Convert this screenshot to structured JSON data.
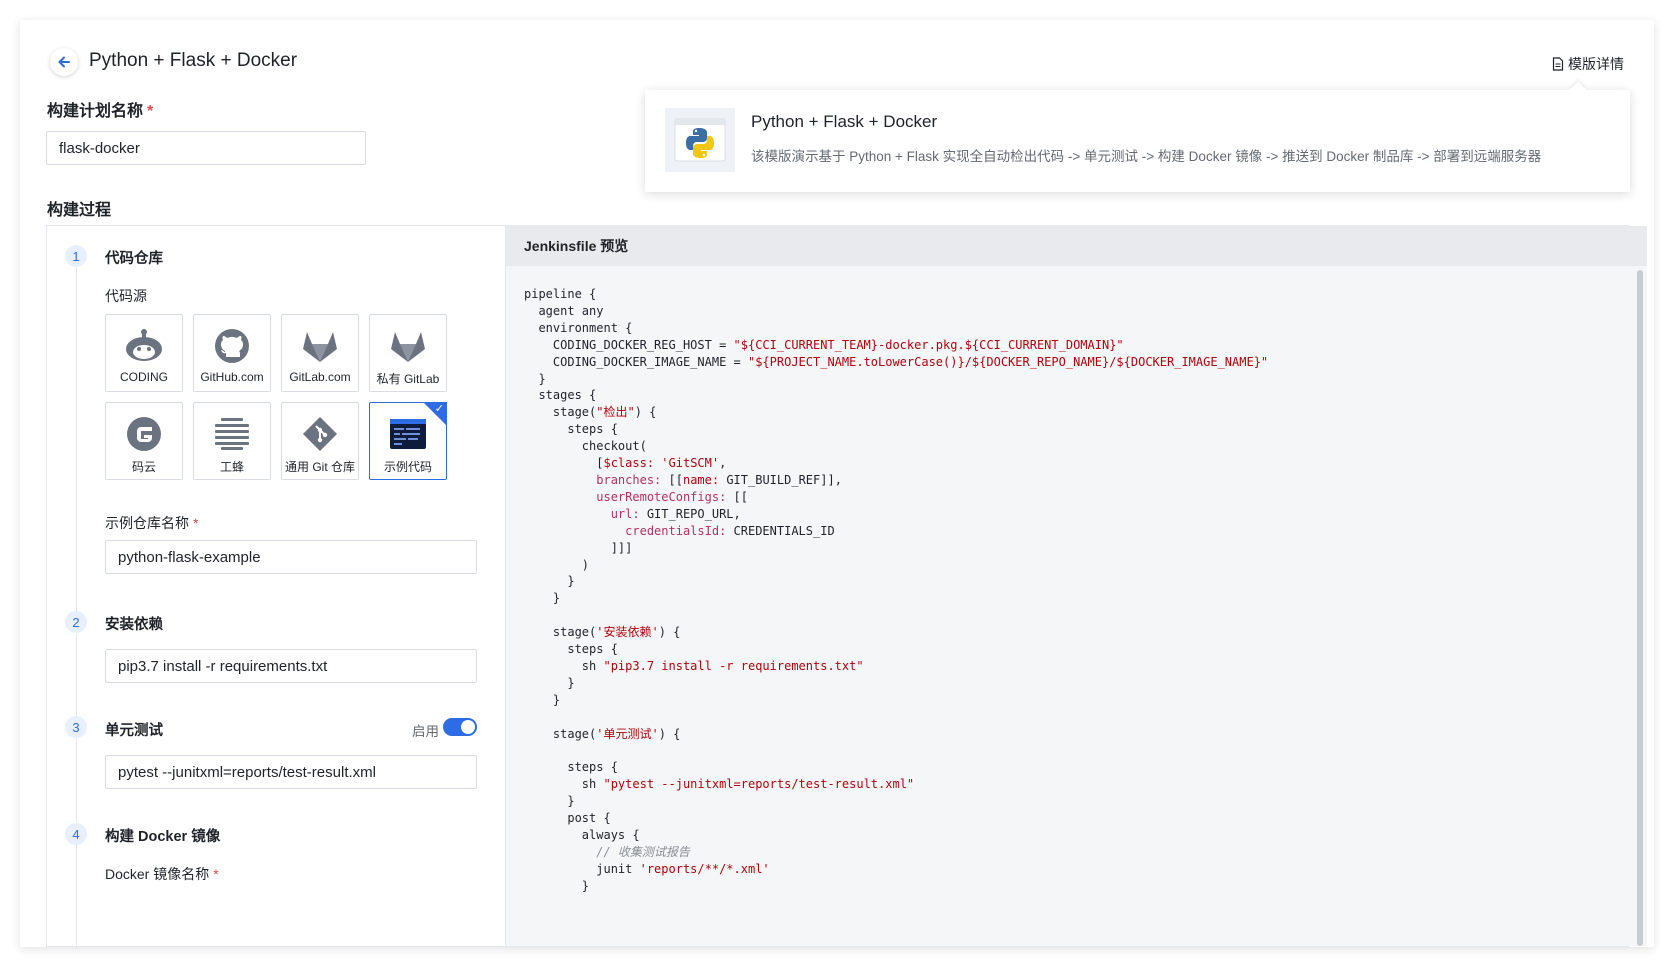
{
  "header": {
    "title": "Python + Flask + Docker",
    "template_link": "模版详情"
  },
  "popover": {
    "title": "Python + Flask + Docker",
    "description": "该模版演示基于 Python + Flask 实现全自动检出代码 -> 单元测试 -> 构建 Docker 镜像 -> 推送到 Docker 制品库 -> 部署到远端服务器"
  },
  "plan": {
    "label": "构建计划名称",
    "required_mark": "*",
    "value": "flask-docker"
  },
  "process": {
    "label": "构建过程",
    "steps": [
      {
        "num": "1",
        "title": "代码仓库"
      },
      {
        "num": "2",
        "title": "安装依赖"
      },
      {
        "num": "3",
        "title": "单元测试"
      },
      {
        "num": "4",
        "title": "构建 Docker 镜像"
      }
    ],
    "source_label": "代码源",
    "sources": [
      {
        "label": "CODING",
        "icon": "coding-icon"
      },
      {
        "label": "GitHub.com",
        "icon": "github-icon"
      },
      {
        "label": "GitLab.com",
        "icon": "gitlab-icon"
      },
      {
        "label": "私有 GitLab",
        "icon": "gitlab-private-icon"
      },
      {
        "label": "码云",
        "icon": "gitee-icon"
      },
      {
        "label": "工蜂",
        "icon": "gongfeng-icon"
      },
      {
        "label": "通用 Git 仓库",
        "icon": "git-icon"
      },
      {
        "label": "示例代码",
        "icon": "sample-code-icon",
        "selected": true
      }
    ],
    "repo_name_label": "示例仓库名称",
    "repo_name_value": "python-flask-example",
    "install_cmd": "pip3.7 install -r requirements.txt",
    "test_toggle_label": "启用",
    "test_cmd": "pytest --junitxml=reports/test-result.xml",
    "docker_image_label": "Docker 镜像名称"
  },
  "jenkinsfile": {
    "title": "Jenkinsfile 预览"
  },
  "colors": {
    "accent": "#2d6ce5",
    "required": "#e54545",
    "code_string": "#b5000a"
  }
}
